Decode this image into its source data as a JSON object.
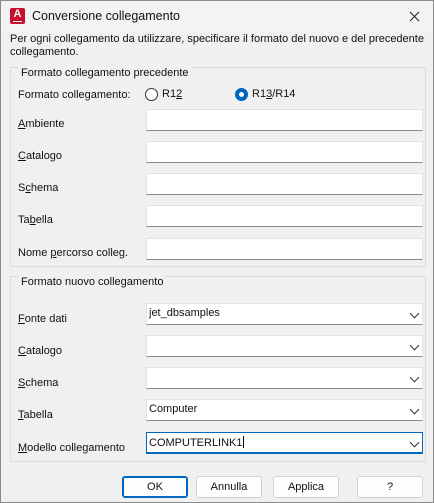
{
  "window": {
    "title": "Conversione collegamento",
    "app_icon_letter": "A",
    "accent_color": "#0067c0",
    "close_icon": "close-icon"
  },
  "intro": "Per ogni collegamento da utilizzare, specificare il formato del nuovo e del precedente collegamento.",
  "old_link": {
    "legend": "Formato collegamento precedente",
    "format_label": "Formato collegamento:",
    "radio_r12": "R12",
    "radio_r13": "R13/R14",
    "selected_format": "R13/R14",
    "rows": [
      {
        "label": "Ambiente",
        "value": ""
      },
      {
        "label": "Catalogo",
        "value": ""
      },
      {
        "label": "Schema",
        "value": ""
      },
      {
        "label": "Tabella",
        "value": ""
      },
      {
        "label": "Nome percorso colleg.",
        "value": ""
      }
    ]
  },
  "new_link": {
    "legend": "Formato nuovo collegamento",
    "rows": [
      {
        "label": "Fonte dati",
        "value": "jet_dbsamples"
      },
      {
        "label": "Catalogo",
        "value": ""
      },
      {
        "label": "Schema",
        "value": ""
      },
      {
        "label": "Tabella",
        "value": "Computer"
      },
      {
        "label": "Modello collegamento",
        "value": "COMPUTERLINK1"
      }
    ]
  },
  "buttons": {
    "ok": "OK",
    "cancel": "Annulla",
    "apply": "Applica",
    "help": "?"
  }
}
